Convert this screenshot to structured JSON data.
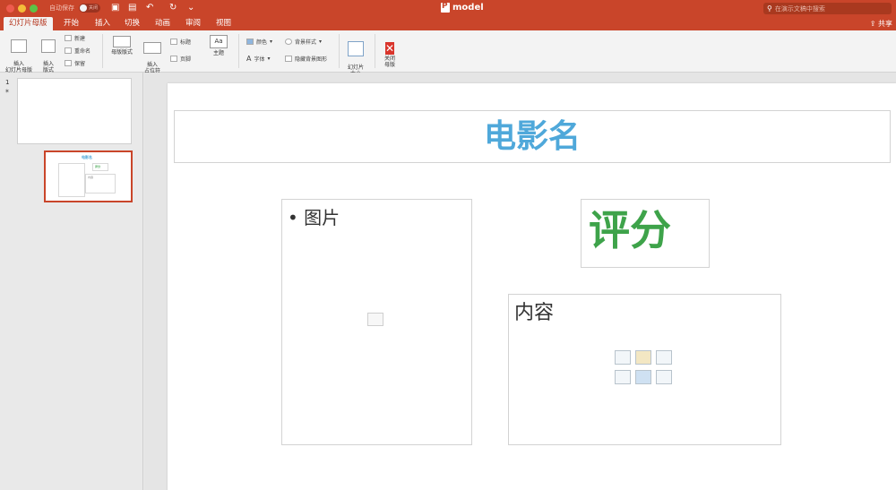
{
  "window": {
    "autosave_label": "自动保存",
    "autosave_toggle": "关闭",
    "title": "model"
  },
  "search": {
    "placeholder": "在演示文稿中搜索"
  },
  "tabs": [
    {
      "label": "幻灯片母版"
    },
    {
      "label": "开始"
    },
    {
      "label": "插入"
    },
    {
      "label": "切换"
    },
    {
      "label": "动画"
    },
    {
      "label": "审阅"
    },
    {
      "label": "视图"
    }
  ],
  "share_label": "共享",
  "ribbon": {
    "insert_master": "插入\n幻灯片母版",
    "insert_layout": "插入\n版式",
    "new": "新建",
    "rename": "重命名",
    "keep": "保留",
    "master_layout": "母版版式",
    "insert_placeholder": "插入\n占位符",
    "title_cb": "标题",
    "footer_cb": "页脚",
    "theme": "主题",
    "theme_sample": "Aa",
    "colors": "颜色",
    "fonts": "字体",
    "bg_styles": "背景样式",
    "hide_bg": "隐藏背景图形",
    "slide_size": "幻灯片\n大小",
    "close_master": "关闭\n母版"
  },
  "thumbnails": {
    "number": "1",
    "layout_title": "电影名",
    "layout_score": "评分",
    "layout_content": "内容"
  },
  "slide": {
    "title": "电影名",
    "picture_label": "图片",
    "score": "评分",
    "content_label": "内容"
  },
  "colors": {
    "accent": "#c9452a",
    "title_blue": "#4fa8da",
    "score_green": "#3ea34a"
  }
}
